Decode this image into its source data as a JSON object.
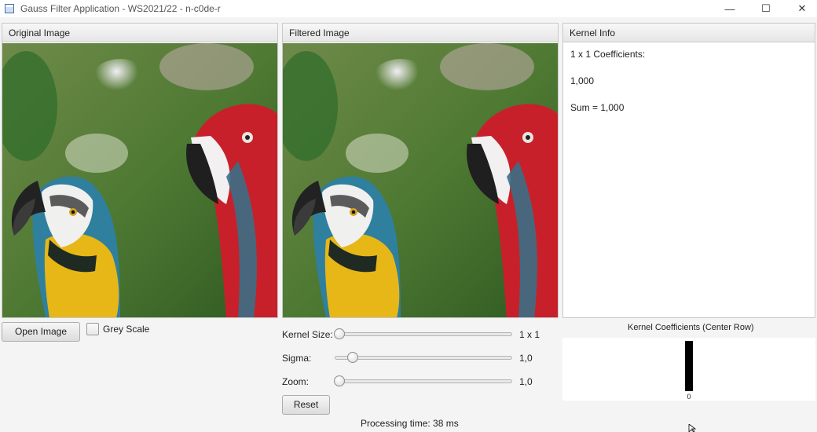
{
  "window": {
    "title": "Gauss Filter Application - WS2021/22 - n-c0de-r",
    "minimize_glyph": "—",
    "maximize_glyph": "☐",
    "close_glyph": "✕"
  },
  "panels": {
    "original_title": "Original Image",
    "filtered_title": "Filtered Image",
    "kernel_info_title": "Kernel Info"
  },
  "kernel_info": {
    "line1": "1 x 1 Coefficients:",
    "line2": "1,000",
    "line3": "Sum = 1,000"
  },
  "controls": {
    "open_image_label": "Open Image",
    "grey_scale_label": "Grey Scale",
    "grey_scale_checked": false,
    "kernel_size_label": "Kernel Size:",
    "kernel_size_value": "1 x 1",
    "kernel_size_fraction": 0.0,
    "sigma_label": "Sigma:",
    "sigma_value": "1,0",
    "sigma_fraction": 0.08,
    "zoom_label": "Zoom:",
    "zoom_value": "1,0",
    "zoom_fraction": 0.0,
    "reset_label": "Reset",
    "processing_time": "Processing time: 38 ms"
  },
  "coeff_chart": {
    "title": "Kernel Coefficients (Center Row)",
    "tick_label": "0",
    "value": 1.0,
    "bar_color": "#000000"
  },
  "colors": {
    "panel_header": "#e6e6e6",
    "background": "#f4f4f4"
  }
}
